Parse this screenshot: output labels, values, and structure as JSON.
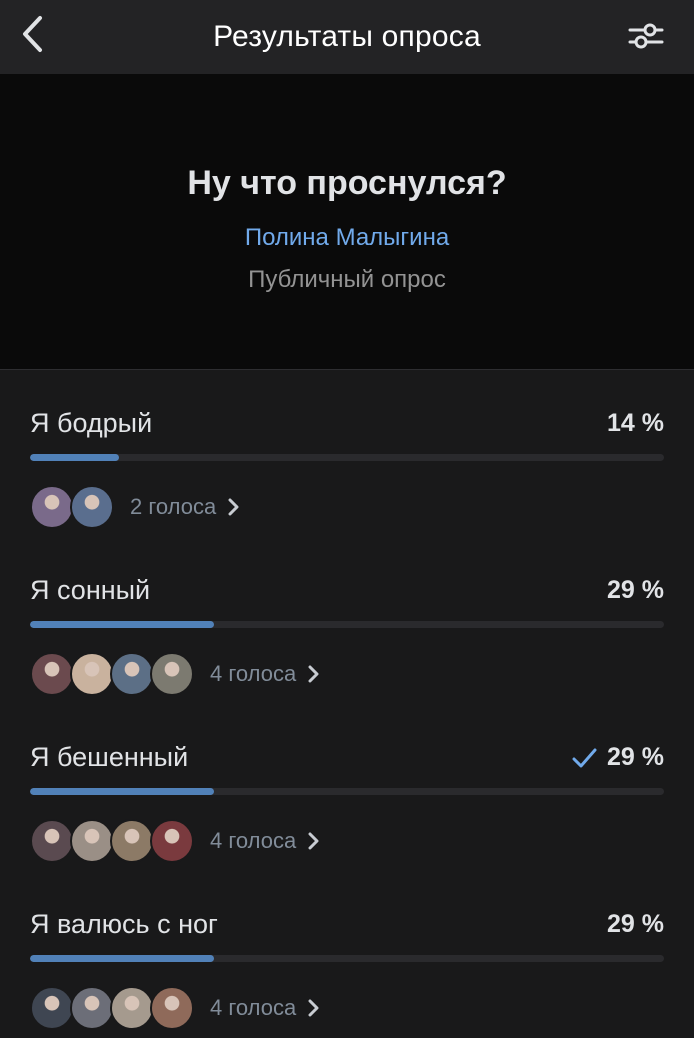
{
  "navbar": {
    "title": "Результаты опроса",
    "back_icon": "chevron-left-icon",
    "filter_icon": "sliders-icon"
  },
  "poll": {
    "question": "Ну что проснулся?",
    "author": "Полина Малыгина",
    "type": "Публичный опрос"
  },
  "colors": {
    "accent": "#5181b8",
    "link": "#71aaeb",
    "background": "#19191a"
  },
  "options": [
    {
      "label": "Я бодрый",
      "percent_text": "14 %",
      "fraction": 0.14,
      "votes_text": "2 голоса",
      "selected": false,
      "avatars": [
        "#7a6a8a",
        "#5a6e8e"
      ]
    },
    {
      "label": "Я сонный",
      "percent_text": "29 %",
      "fraction": 0.29,
      "votes_text": "4 голоса",
      "selected": false,
      "avatars": [
        "#6b4a4e",
        "#c9b29e",
        "#5c6f86",
        "#7c7a70"
      ]
    },
    {
      "label": "Я бешенный",
      "percent_text": "29 %",
      "fraction": 0.29,
      "votes_text": "4 голоса",
      "selected": true,
      "avatars": [
        "#5a4a50",
        "#9a8f86",
        "#8c7a66",
        "#7a3a3e"
      ]
    },
    {
      "label": "Я валюсь с ног",
      "percent_text": "29 %",
      "fraction": 0.29,
      "votes_text": "4 голоса",
      "selected": false,
      "avatars": [
        "#3f4652",
        "#6c6e78",
        "#a59a8e",
        "#8f6a5a"
      ]
    }
  ]
}
